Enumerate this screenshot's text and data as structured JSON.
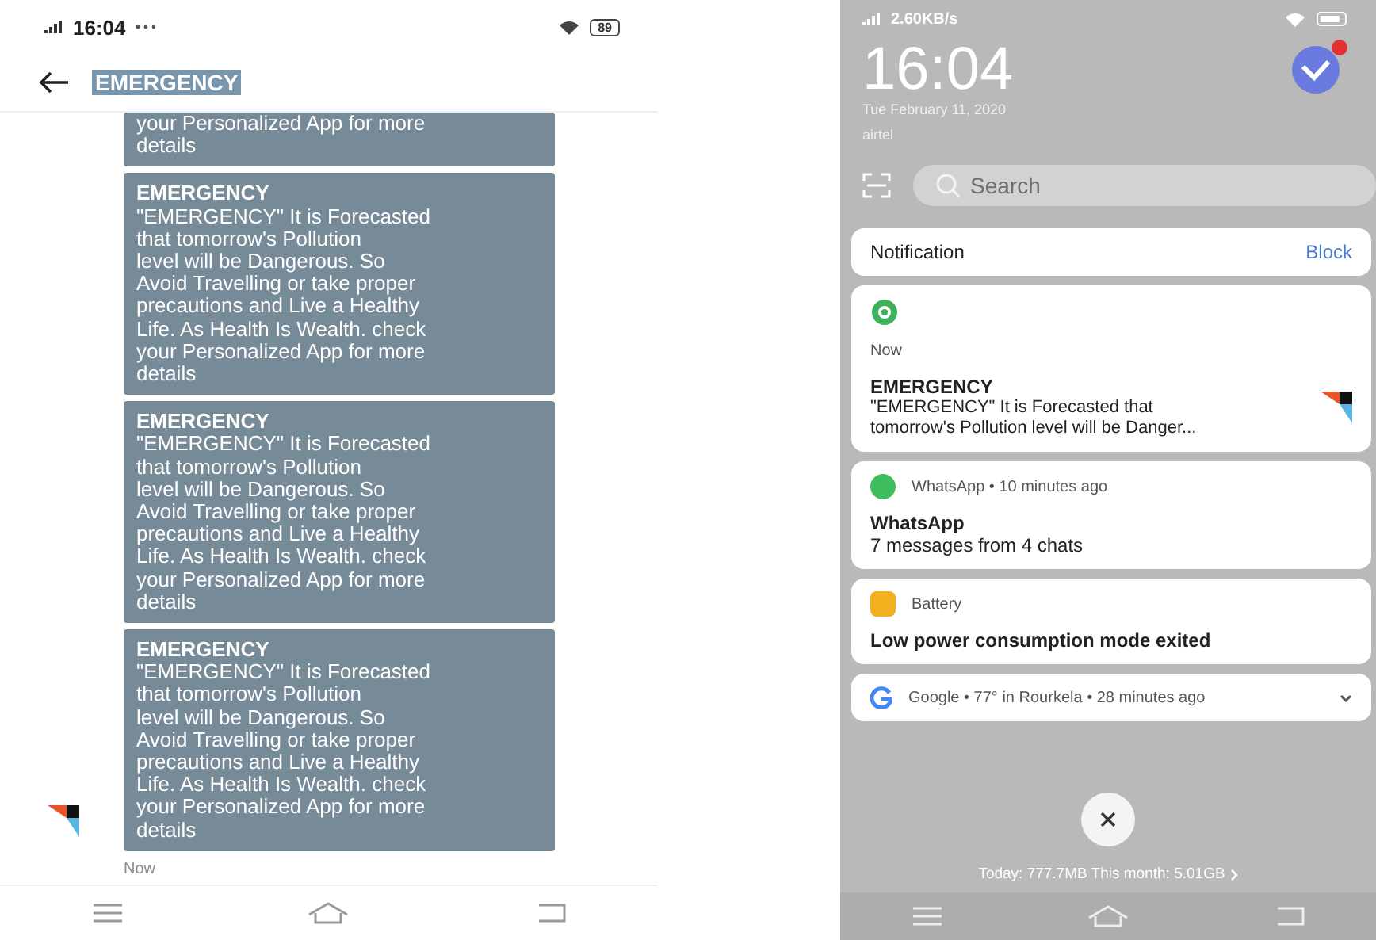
{
  "left_phone": {
    "status_bar": {
      "time": "16:04",
      "battery": "89"
    },
    "header": {
      "title": "EMERGENCY",
      "title_selected": true
    },
    "messages": [
      {
        "body": "your Personalized App for more\ndetails"
      },
      {
        "title": "EMERGENCY",
        "body": "\"EMERGENCY\" It is Forecasted\nthat tomorrow's Pollution\nlevel will be Dangerous. So\nAvoid Travelling or take proper\nprecautions and Live a Healthy\nLife. As Health Is Wealth. check\nyour Personalized App for more\ndetails"
      },
      {
        "title": "EMERGENCY",
        "body": "\"EMERGENCY\" It is Forecasted\nthat tomorrow's Pollution\nlevel will be Dangerous. So\nAvoid Travelling or take proper\nprecautions and Live a Healthy\nLife. As Health Is Wealth. check\nyour Personalized App for more\ndetails"
      },
      {
        "title": "EMERGENCY",
        "body": "\"EMERGENCY\" It is Forecasted\nthat tomorrow's Pollution\nlevel will be Dangerous. So\nAvoid Travelling or take proper\nprecautions and Live a Healthy\nLife. As Health Is Wealth. check\nyour Personalized App for more\ndetails"
      }
    ],
    "last_time": "Now"
  },
  "right_phone": {
    "status_bar": {
      "speed": "2.60KB/s"
    },
    "clock": "16:04",
    "date": "Tue February 11, 2020",
    "carrier": "airtel",
    "search": {
      "placeholder": "Search"
    },
    "notification_header": {
      "label": "Notification",
      "action": "Block"
    },
    "notifications": [
      {
        "kind": "message",
        "time": "Now",
        "title": "EMERGENCY",
        "text": "\"EMERGENCY\" It is Forecasted that\ntomorrow's Pollution level will be Danger..."
      },
      {
        "kind": "app",
        "app": "WhatsApp • 10 minutes ago",
        "title": "WhatsApp",
        "text": "7 messages from 4 chats",
        "color": "#3ebd5c"
      },
      {
        "kind": "app",
        "app": "Battery",
        "title": "Low power consumption mode exited",
        "color": "#f2b01e"
      },
      {
        "kind": "compact",
        "app": "Google • 77° in Rourkela • 28 minutes ago"
      }
    ],
    "data_usage": "Today: 777.7MB This month: 5.01GB"
  }
}
